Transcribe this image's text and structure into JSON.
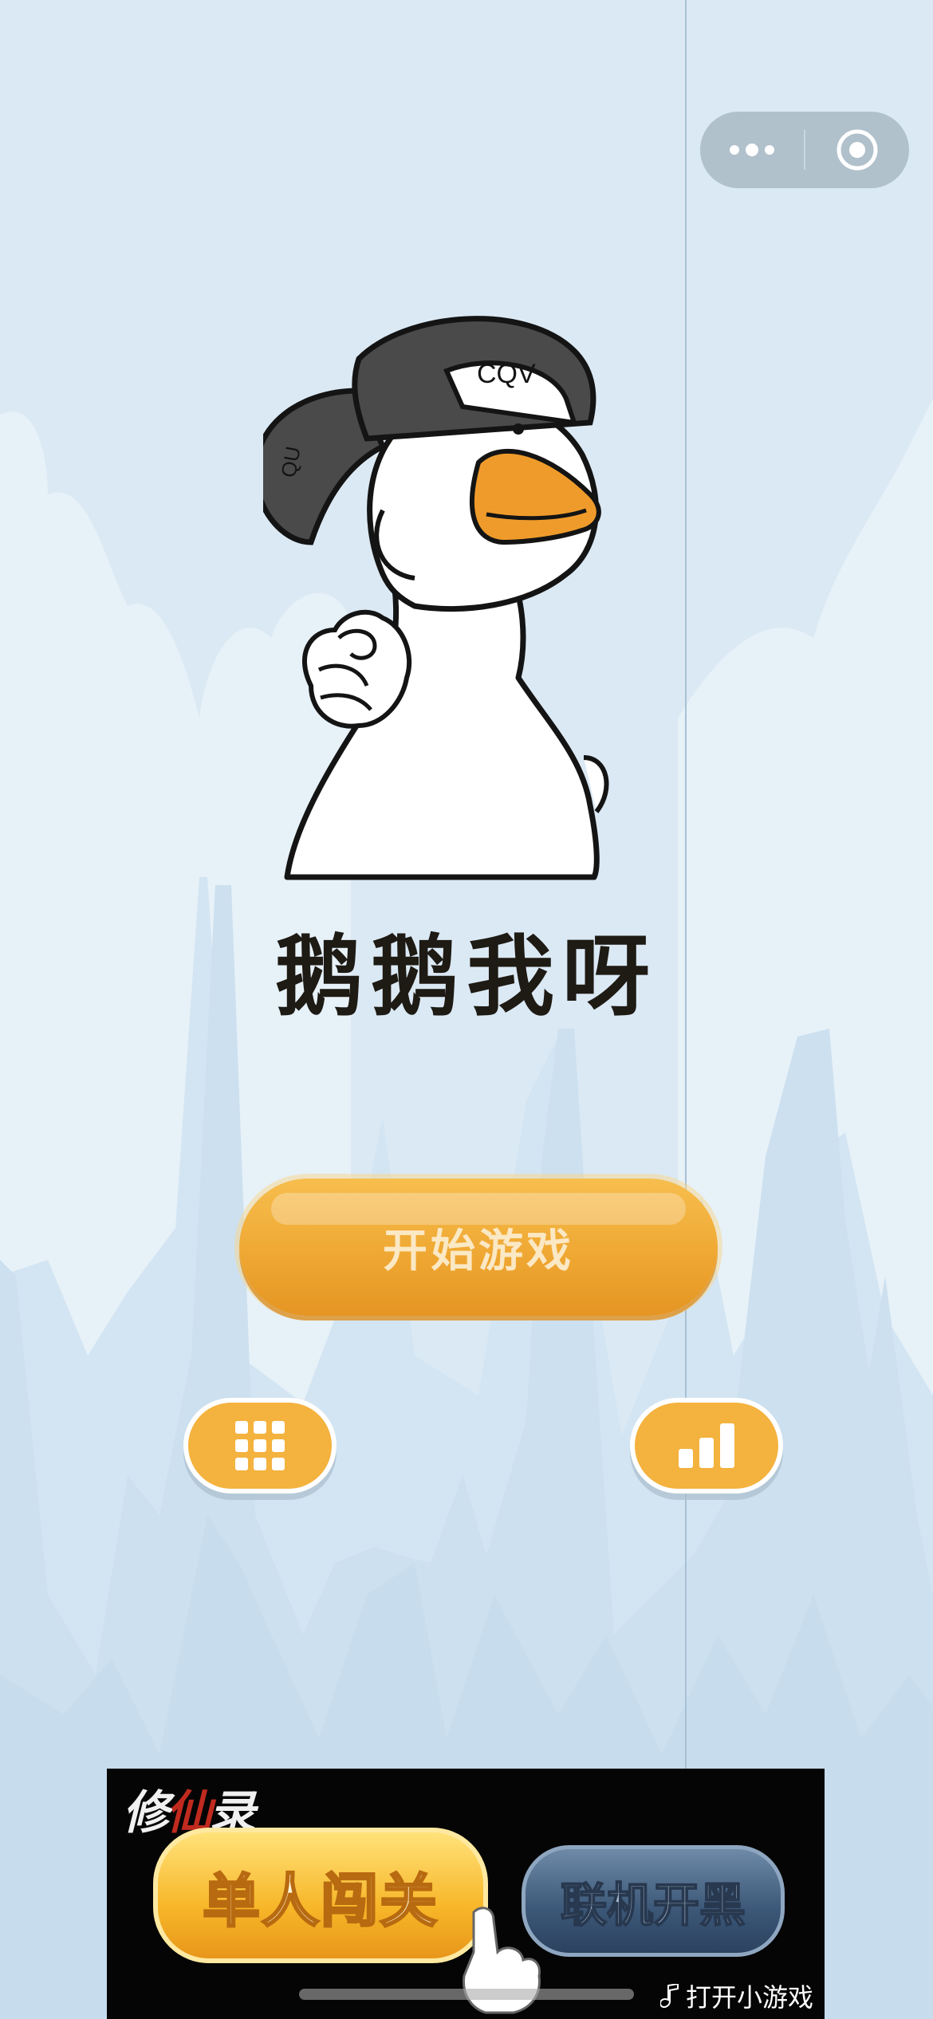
{
  "capsule": {
    "more_icon": "more-dots-icon",
    "close_icon": "target-circle-icon"
  },
  "game": {
    "title": "鹅鹅我呀",
    "start_label": "开始游戏",
    "menu_icon": "grid-icon",
    "rank_icon": "bar-chart-icon",
    "cap_text": "CQV"
  },
  "ad": {
    "logo_text_1": "修",
    "logo_text_2": "仙",
    "logo_text_3": "录",
    "single_label": "单人闯关",
    "multi_label": "联机开黑",
    "open_label": "打开小游戏",
    "open_icon": "music-note-icon"
  },
  "colors": {
    "background": "#dbe9f4",
    "button_orange": "#efa833",
    "accent_orange": "#f4b23e",
    "beak": "#ef9b2b"
  }
}
